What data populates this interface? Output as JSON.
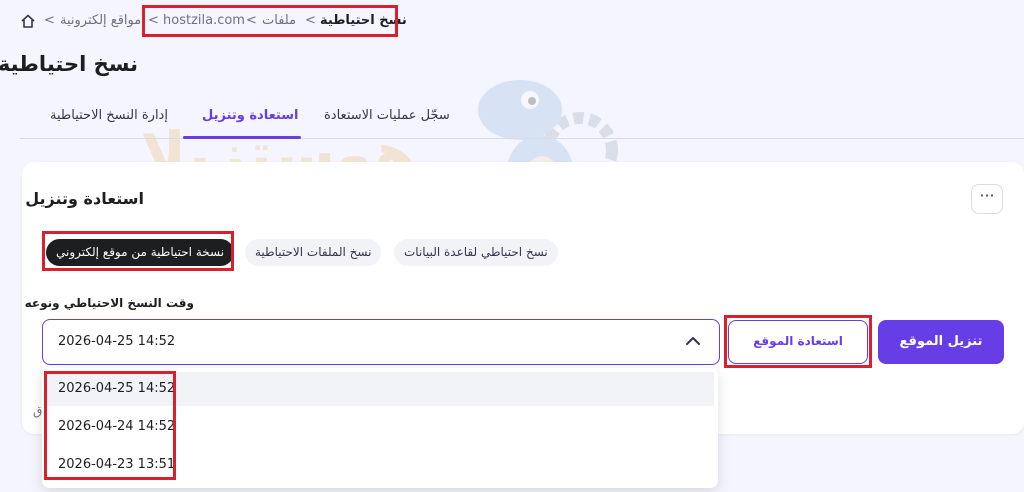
{
  "breadcrumb": {
    "items": [
      "مواقع إلكترونية",
      "hostzila.com",
      "ملفات",
      "نسخ احتياطية"
    ]
  },
  "page": {
    "title": "نسخ احتياطية"
  },
  "tabs": [
    {
      "label": "سجّل عمليات الاستعادة",
      "active": false
    },
    {
      "label": "استعادة وتنزيل",
      "active": true
    },
    {
      "label": "إدارة النسخ الاحتياطية",
      "active": false
    }
  ],
  "card": {
    "title": "استعادة وتنزيل",
    "menu_label": "···",
    "chips": [
      {
        "label": "نسخ احتياطي لقاعدة البيانات",
        "active": false
      },
      {
        "label": "نسخ الملفات الاحتياطية",
        "active": false
      },
      {
        "label": "نسخة احتياطية من موقع إلكتروني",
        "active": true
      }
    ],
    "field_label": "وقت النسخ الاحتياطي ونوعه",
    "selected_value": "2026-04-25 14:52",
    "options": [
      "2026-04-25 14:52",
      "2026-04-24 14:52",
      "2026-04-23 13:51"
    ],
    "restore_button": "استعادة الموقع",
    "download_button": "تنزيل الموقع",
    "partial_text": "ق"
  },
  "watermark": {
    "text": "هوستزيلا"
  },
  "colors": {
    "accent": "#673de6",
    "highlight": "#d8202f",
    "watermark": "#e8a83c"
  },
  "icons": [
    "home-icon",
    "chevron-left-icon",
    "chevron-up-icon",
    "more-icon",
    "dino-mascot"
  ]
}
